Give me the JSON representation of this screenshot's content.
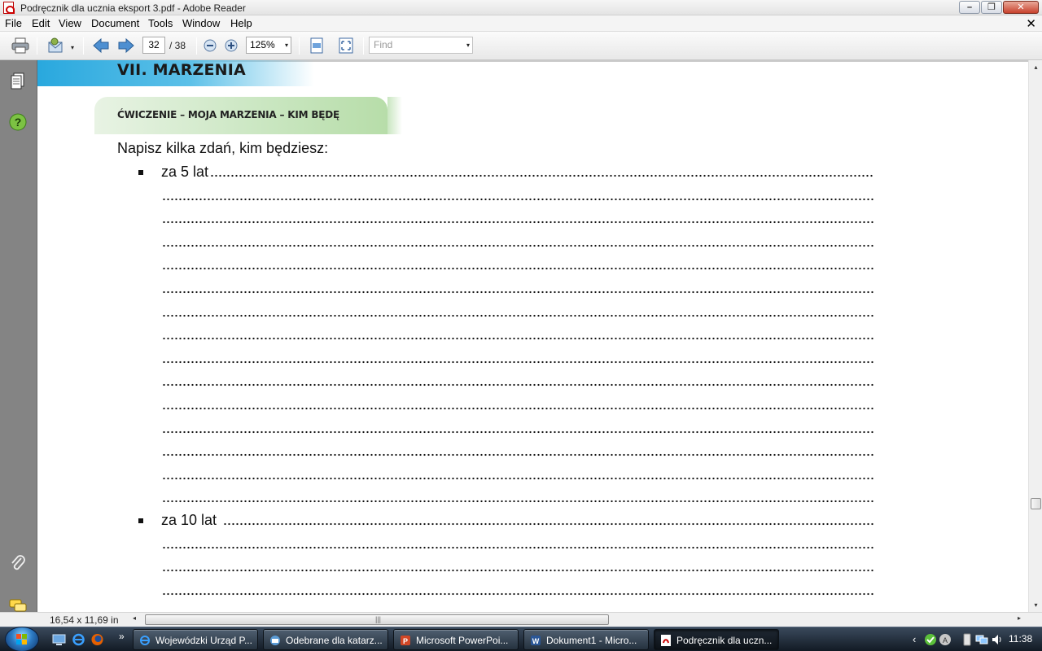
{
  "window": {
    "title": "Podręcznik dla ucznia eksport 3.pdf - Adobe Reader",
    "min_glyph": "–",
    "max_glyph": "❐",
    "close_glyph": "✕"
  },
  "menu": {
    "items": [
      "File",
      "Edit",
      "View",
      "Document",
      "Tools",
      "Window",
      "Help"
    ],
    "doc_close": "✕"
  },
  "toolbar": {
    "current_page": "32",
    "total_pages": "/ 38",
    "zoom": "125%",
    "find_placeholder": "Find",
    "dropdown_glyph": "▾"
  },
  "document": {
    "chapter_title": "VII. MARZENIA",
    "exercise_title": "ĆWICZENIE – MOJA MARZENIA – KIM BĘDĘ",
    "prompt": "Napisz kilka zdań, kim będziesz:",
    "items": [
      {
        "label": "za 5 lat",
        "extra_lines": 14
      },
      {
        "label": "za  10  lat",
        "extra_lines": 3
      }
    ],
    "accent_colors": {
      "chapter_band": "#29a8de",
      "exercise_banner": "#b7dda9"
    }
  },
  "statusbar": {
    "page_size": "16,54 x 11,69 in",
    "scroll_left": "◂",
    "scroll_right": "▸",
    "grip": "|||"
  },
  "scrollbar": {
    "up": "▴",
    "down": "▾"
  },
  "taskbar": {
    "quick_launch_more": "»",
    "tasks": [
      {
        "label": "Wojewódzki Urząd P...",
        "icon": "internet-explorer-icon"
      },
      {
        "label": "Odebrane dla katarz...",
        "icon": "mail-icon"
      },
      {
        "label": "Microsoft PowerPoi...",
        "icon": "powerpoint-icon"
      },
      {
        "label": "Dokument1 - Micro...",
        "icon": "word-icon"
      },
      {
        "label": "Podręcznik dla uczn...",
        "icon": "adobe-reader-icon"
      }
    ],
    "clock": "11:38",
    "tray_expand": "‹"
  }
}
